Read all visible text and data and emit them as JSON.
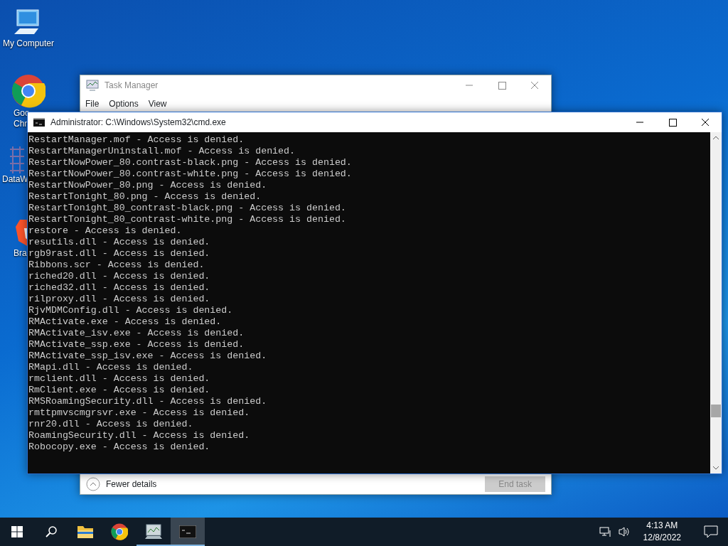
{
  "desktop_icons": [
    {
      "kind": "computer",
      "label_lines": [
        "My Computer"
      ]
    },
    {
      "kind": "chrome",
      "label_lines": [
        "Goo",
        "Chr"
      ]
    },
    {
      "kind": "grid",
      "label_lines": [
        "DataW"
      ]
    },
    {
      "kind": "lion",
      "label_lines": [
        "Bra"
      ]
    }
  ],
  "task_manager": {
    "title": "Task Manager",
    "menu": [
      "File",
      "Options",
      "View"
    ],
    "fewer_details": "Fewer details",
    "end_task": {
      "label": "End task",
      "disabled": true
    }
  },
  "cmd_window": {
    "title": "Administrator:  C:\\Windows\\System32\\cmd.exe",
    "lines": [
      "RestartManager.mof - Access is denied.",
      "RestartManagerUninstall.mof - Access is denied.",
      "RestartNowPower_80.contrast-black.png - Access is denied.",
      "RestartNowPower_80.contrast-white.png - Access is denied.",
      "RestartNowPower_80.png - Access is denied.",
      "RestartTonight_80.png - Access is denied.",
      "RestartTonight_80_contrast-black.png - Access is denied.",
      "RestartTonight_80_contrast-white.png - Access is denied.",
      "restore - Access is denied.",
      "resutils.dll - Access is denied.",
      "rgb9rast.dll - Access is denied.",
      "Ribbons.scr - Access is denied.",
      "riched20.dll - Access is denied.",
      "riched32.dll - Access is denied.",
      "rilproxy.dll - Access is denied.",
      "RjvMDMConfig.dll - Access is denied.",
      "RMActivate.exe - Access is denied.",
      "RMActivate_isv.exe - Access is denied.",
      "RMActivate_ssp.exe - Access is denied.",
      "RMActivate_ssp_isv.exe - Access is denied.",
      "RMapi.dll - Access is denied.",
      "rmclient.dll - Access is denied.",
      "RmClient.exe - Access is denied.",
      "RMSRoamingSecurity.dll - Access is denied.",
      "rmttpmvscmgrsvr.exe - Access is denied.",
      "rnr20.dll - Access is denied.",
      "RoamingSecurity.dll - Access is denied.",
      "Robocopy.exe - Access is denied."
    ]
  },
  "taskbar": {
    "apps": [
      {
        "kind": "search",
        "running": false,
        "active": false
      },
      {
        "kind": "folder",
        "running": false,
        "active": false
      },
      {
        "kind": "chrome",
        "running": false,
        "active": false
      },
      {
        "kind": "taskmgr",
        "running": true,
        "active": false
      },
      {
        "kind": "cmd",
        "running": true,
        "active": true
      }
    ],
    "time": "4:13 AM",
    "date": "12/8/2022"
  }
}
